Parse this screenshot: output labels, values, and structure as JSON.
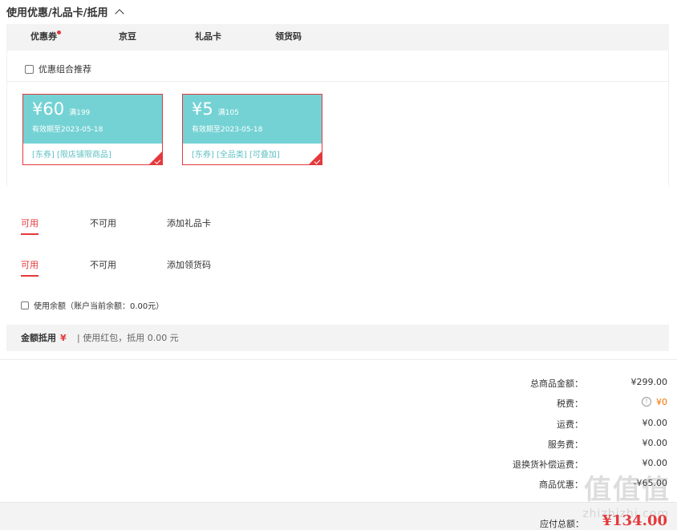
{
  "section": {
    "title": "使用优惠/礼品卡/抵用"
  },
  "tabs": [
    {
      "label": "优惠券"
    },
    {
      "label": "京豆"
    },
    {
      "label": "礼品卡"
    },
    {
      "label": "领货码"
    }
  ],
  "coupon_panel": {
    "combo_label": "优惠组合推荐",
    "coupons": [
      {
        "amount": "¥60",
        "condition": "满199",
        "validity": "有效期至2023-05-18",
        "tags": "[东券] [限店铺限商品]"
      },
      {
        "amount": "¥5",
        "condition": "满105",
        "validity": "有效期至2023-05-18",
        "tags": "[东券] [全品类] [可叠加]"
      }
    ]
  },
  "gift_card": {
    "tabs": [
      "可用",
      "不可用",
      "添加礼品卡"
    ]
  },
  "redeem_code": {
    "tabs": [
      "可用",
      "不可用",
      "添加领货码"
    ]
  },
  "balance": {
    "label": "使用余额（账户当前余额：0.00元）"
  },
  "deduct": {
    "label": "金额抵用",
    "yen": "¥",
    "redpacket": "| 使用红包，抵用 0.00 元"
  },
  "summary": [
    {
      "key": "总商品金额：",
      "value": "¥299.00"
    },
    {
      "key": "税费：",
      "value": "¥0",
      "info": "!"
    },
    {
      "key": "运费：",
      "value": "¥0.00"
    },
    {
      "key": "服务费：",
      "value": "¥0.00"
    },
    {
      "key": "退换货补偿运费：",
      "value": "¥0.00"
    },
    {
      "key": "商品优惠：",
      "value": "-¥65.00"
    }
  ],
  "total": {
    "key": "应付总额：",
    "value": "¥134.00"
  },
  "watermark": {
    "main": "值值值",
    "sub": "zhizhizhi.com"
  },
  "colors": {
    "accent": "#e4393c",
    "coupon_bg": "#74d2d4",
    "tax_orange": "#f07400"
  }
}
